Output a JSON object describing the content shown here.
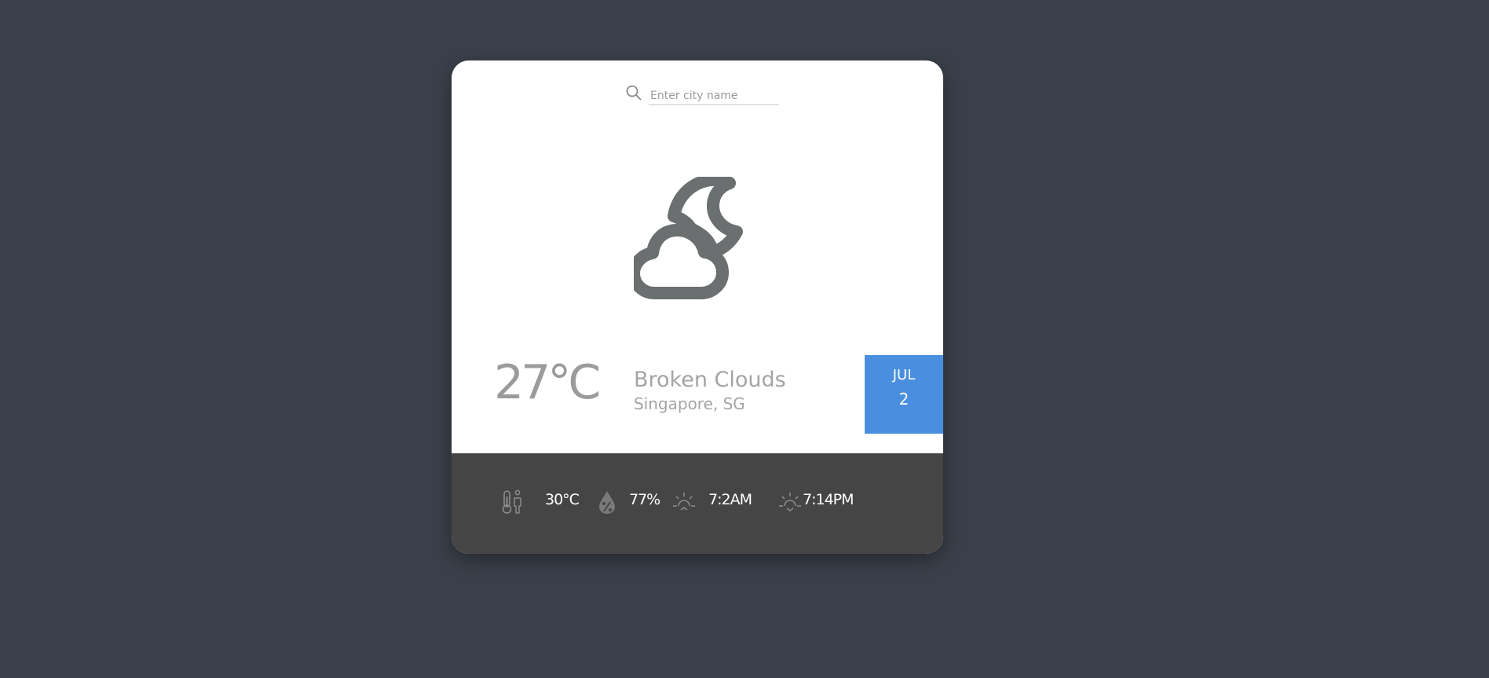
{
  "search": {
    "placeholder": "Enter city name",
    "value": ""
  },
  "weather": {
    "icon": "cloud-moon-icon",
    "temperature": "27°C",
    "description": "Broken Clouds",
    "location": "Singapore, SG"
  },
  "date": {
    "month": "JUL",
    "day": "2"
  },
  "details": {
    "feels_like": {
      "icon": "thermometer-person-icon",
      "value": "30°C"
    },
    "humidity": {
      "icon": "humidity-drop-icon",
      "value": "77%"
    },
    "sunrise": {
      "icon": "sunrise-icon",
      "value": "7:2AM"
    },
    "sunset": {
      "icon": "sunset-icon",
      "value": "7:14PM"
    }
  },
  "colors": {
    "background": "#3a4049",
    "card": "#ffffff",
    "footer": "#454545",
    "accent": "#4a8fdf",
    "icon": "#6b6f70"
  }
}
